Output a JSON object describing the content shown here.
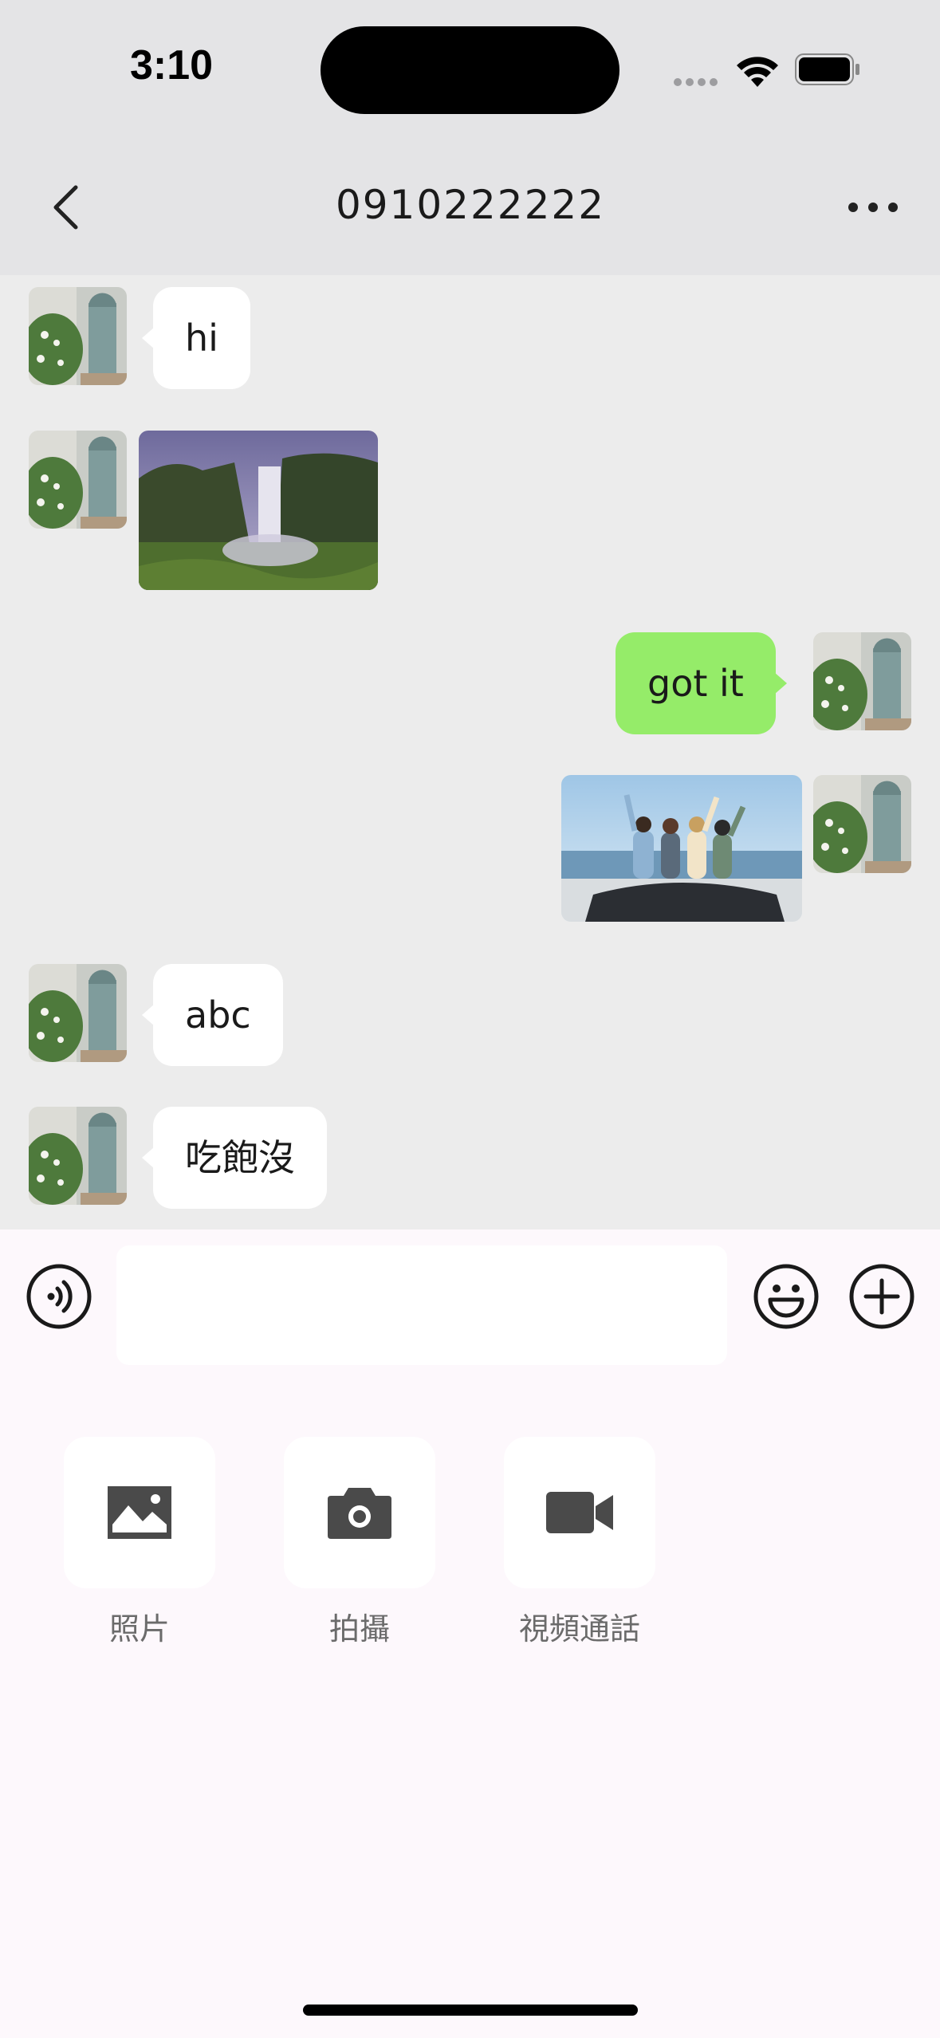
{
  "status_bar": {
    "time": "3:10"
  },
  "header": {
    "title": "0910222222"
  },
  "messages": [
    {
      "side": "left",
      "type": "text",
      "text": "hi"
    },
    {
      "side": "left",
      "type": "image",
      "image": "waterfall-landscape"
    },
    {
      "side": "right",
      "type": "text",
      "text": "got it"
    },
    {
      "side": "right",
      "type": "image",
      "image": "friends-in-convertible"
    },
    {
      "side": "left",
      "type": "text",
      "text": "abc"
    },
    {
      "side": "left",
      "type": "text",
      "text": "吃飽沒"
    }
  ],
  "input": {
    "value": "",
    "placeholder": ""
  },
  "tools": [
    {
      "label": "照片",
      "icon": "image-icon"
    },
    {
      "label": "拍攝",
      "icon": "camera-icon"
    },
    {
      "label": "視頻通話",
      "icon": "video-camera-icon"
    }
  ],
  "colors": {
    "sent_bubble": "#95EC69",
    "received_bubble": "#FFFFFF",
    "chat_background": "#ECECEC",
    "header_background": "#E4E4E6",
    "input_panel_background": "#FDF8FC"
  }
}
